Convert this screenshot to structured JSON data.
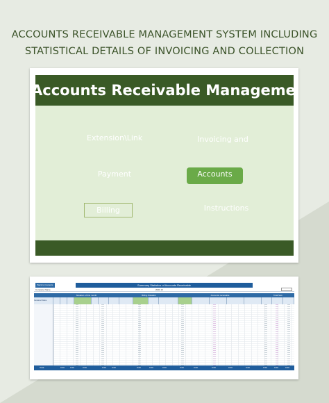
{
  "page": {
    "heading_line1": "ACCOUNTS RECEIVABLE MANAGEMENT SYSTEM INCLUDING",
    "heading_line2": "STATISTICAL DETAILS OF INVOICING AND COLLECTION",
    "colors": {
      "background": "#e7ebe3",
      "heading_text": "#3a5228",
      "banner": "#3a5a26",
      "menu_background": "#e2eed7",
      "active_button": "#6aaa48",
      "sheet_header": "#1f5d9c"
    }
  },
  "dashboard": {
    "title": "Accounts Receivable Management System",
    "menu": {
      "item_a": "Extension\\Link",
      "item_b": "Invoicing and",
      "item_c": "Payment",
      "item_d": "Accounts",
      "item_e": "Billing",
      "item_f": "Instructions"
    }
  },
  "sheet": {
    "back_label": "Back to Contents",
    "title": "Summary Statistics of Accounts Receivable",
    "sub_left": "Company Name",
    "sub_mid": "2021  10",
    "groups": [
      "Situation of this month",
      "Billing Situation",
      "Accounts receivable",
      "Total Sum"
    ],
    "first_col_header": "Customer Name",
    "totals_label": "Total",
    "totals_values": [
      "0.00",
      "0.00",
      "0.00",
      "0.00",
      "0.00",
      "0.00",
      "0.00",
      "0.00",
      "0.00",
      "0.00",
      "0.00",
      "0.00",
      "0.00",
      "0.00",
      "0.00",
      "0.00",
      "0.00",
      "0.00",
      "0.00",
      "0.00",
      "0.00"
    ]
  }
}
